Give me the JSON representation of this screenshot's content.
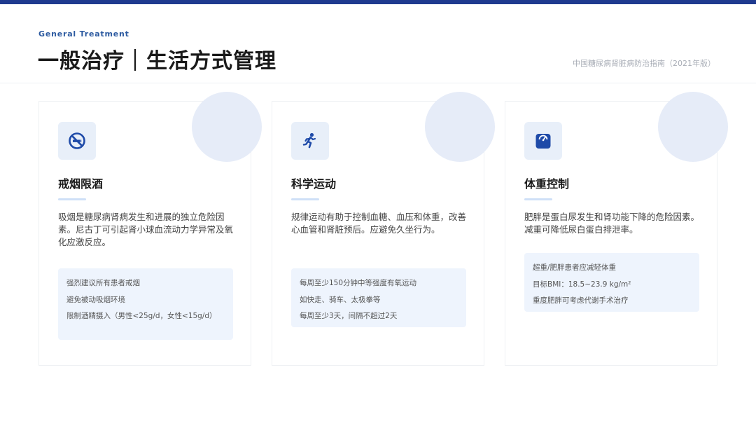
{
  "header": {
    "eyebrow": "General Treatment",
    "title": "一般治疗｜生活方式管理",
    "source": "中国糖尿病肾脏病防治指南（2021年版）"
  },
  "colors": {
    "top_bar": "#1f3a8f",
    "accent": "#2c5aa0",
    "icon_fill": "#1e4aa8",
    "card_tint": "#eef4fd"
  },
  "cards": [
    {
      "icon": "no-smoking-icon",
      "title": "戒烟限酒",
      "description": "吸烟是糖尿病肾病发生和进展的独立危险因素。尼古丁可引起肾小球血流动力学异常及氧化应激反应。",
      "points": [
        "强烈建议所有患者戒烟",
        "避免被动吸烟环境",
        "限制酒精摄入（男性<25g/d，女性<15g/d）"
      ]
    },
    {
      "icon": "running-icon",
      "title": "科学运动",
      "description": "规律运动有助于控制血糖、血压和体重，改善心血管和肾脏预后。应避免久坐行为。",
      "points": [
        "每周至少150分钟中等强度有氧运动",
        "如快走、骑车、太极拳等",
        "每周至少3天，间隔不超过2天"
      ]
    },
    {
      "icon": "weight-scale-icon",
      "title": "体重控制",
      "description": "肥胖是蛋白尿发生和肾功能下降的危险因素。减重可降低尿白蛋白排泄率。",
      "points": [
        "超重/肥胖患者应减轻体重",
        "目标BMI：18.5~23.9 kg/m²",
        "重度肥胖可考虑代谢手术治疗"
      ]
    }
  ]
}
